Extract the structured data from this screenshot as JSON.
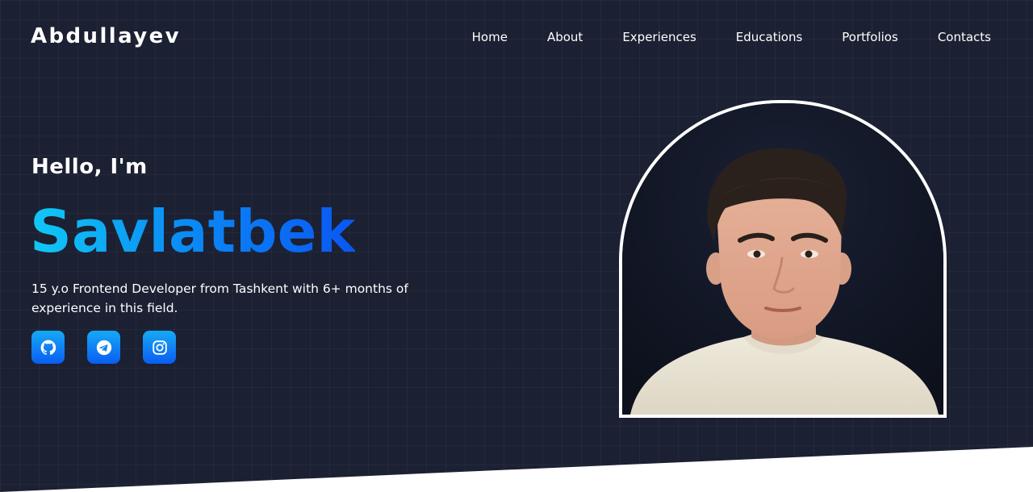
{
  "header": {
    "logo": "Abdullayev",
    "nav": [
      "Home",
      "About",
      "Experiences",
      "Educations",
      "Portfolios",
      "Contacts"
    ]
  },
  "hero": {
    "greeting": "Hello, I'm",
    "name": "Savlatbek",
    "bio": "15 y.o Frontend Developer from Tashkent with 6+ months of experience in this field.",
    "socials": [
      {
        "icon": "github-icon"
      },
      {
        "icon": "telegram-icon"
      },
      {
        "icon": "instagram-icon"
      }
    ]
  },
  "colors": {
    "background": "#1b2033",
    "name_gradient_start": "#10c9f5",
    "name_gradient_end": "#0a57f2",
    "social_button": "#0b7ff3",
    "frame_border": "#ffffff"
  }
}
